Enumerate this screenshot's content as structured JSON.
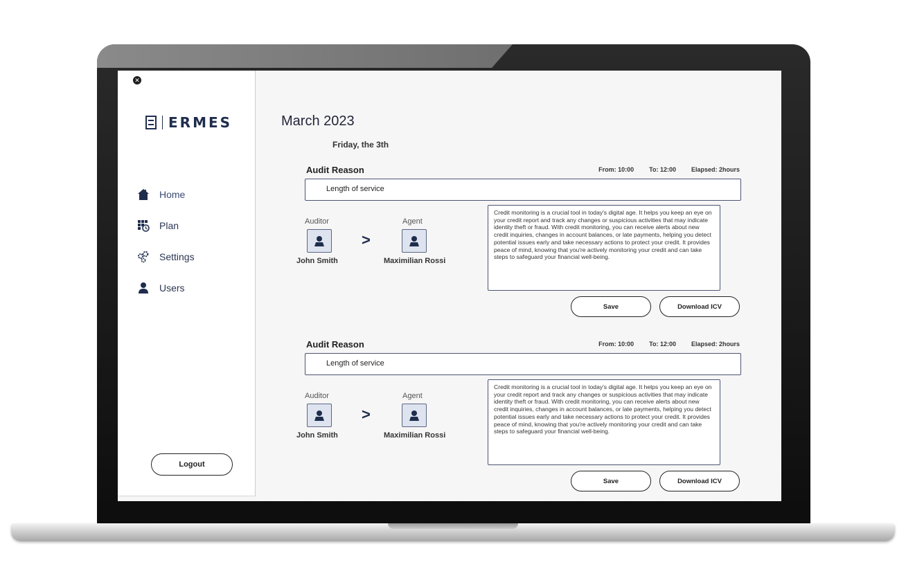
{
  "sidebar": {
    "brand": "ERMES",
    "nav": [
      {
        "label": "Home",
        "icon": "home-icon"
      },
      {
        "label": "Plan",
        "icon": "calendar-clock-icon"
      },
      {
        "label": "Settings",
        "icon": "gears-icon"
      },
      {
        "label": "Users",
        "icon": "user-icon"
      }
    ],
    "logout_label": "Logout"
  },
  "header": {
    "month": "March 2023",
    "day": "Friday, the 3th"
  },
  "audits": [
    {
      "title": "Audit Reason",
      "from": "From: 10:00",
      "to": "To: 12:00",
      "elapsed": "Elapsed: 2hours",
      "reason": "Length of service",
      "auditor_role": "Auditor",
      "agent_role": "Agent",
      "auditor_name": "John Smith",
      "agent_name": "Maximilian Rossi",
      "arrow": ">",
      "description": "Credit monitoring is a crucial tool in today's digital age. It helps you keep an eye on your credit report and track any changes or suspicious activities that may indicate identity theft or fraud. With credit monitoring, you can receive alerts about new credit inquiries, changes in account balances, or late payments, helping you detect potential issues early and take necessary actions to protect your credit. It provides peace of mind, knowing that you're actively monitoring your credit and can take steps to safeguard your financial well-being.",
      "save_label": "Save",
      "download_label": "Download ICV"
    },
    {
      "title": "Audit Reason",
      "from": "From: 10:00",
      "to": "To: 12:00",
      "elapsed": "Elapsed: 2hours",
      "reason": "Length of service",
      "auditor_role": "Auditor",
      "agent_role": "Agent",
      "auditor_name": "John Smith",
      "agent_name": "Maximilian Rossi",
      "arrow": ">",
      "description": "Credit monitoring is a crucial tool in today's digital age. It helps you keep an eye on your credit report and track any changes or suspicious activities that may indicate identity theft or fraud. With credit monitoring, you can receive alerts about new credit inquiries, changes in account balances, or late payments, helping you detect potential issues early and take necessary actions to protect your credit. It provides peace of mind, knowing that you're actively monitoring your credit and can take steps to safeguard your financial well-being.",
      "save_label": "Save",
      "download_label": "Download ICV"
    }
  ],
  "colors": {
    "brand_navy": "#1f2d4d",
    "screen_bg": "#f7f6f6",
    "avatar_bg": "#dde4ef"
  }
}
